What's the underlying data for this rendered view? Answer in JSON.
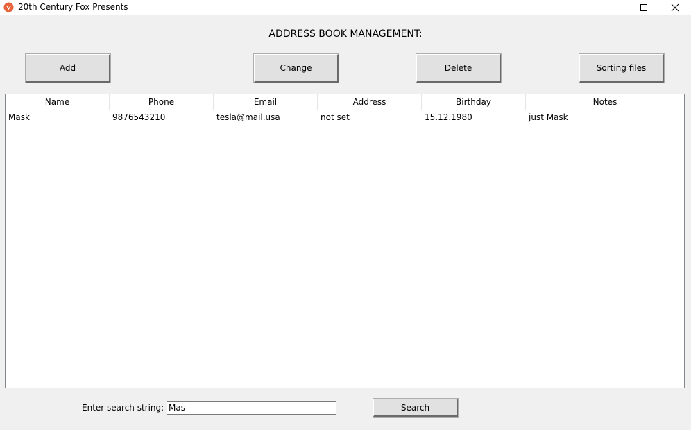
{
  "window": {
    "title": "20th Century Fox Presents",
    "icon": "app-icon",
    "controls": [
      "minimize-icon",
      "maximize-icon",
      "close-icon"
    ]
  },
  "heading": "ADDRESS BOOK MANAGEMENT:",
  "toolbar": {
    "add_label": "Add",
    "change_label": "Change",
    "delete_label": "Delete",
    "sort_label": "Sorting files"
  },
  "table": {
    "columns": [
      "Name",
      "Phone",
      "Email",
      "Address",
      "Birthday",
      "Notes"
    ],
    "rows": [
      [
        "Mask",
        "9876543210",
        "tesla@mail.usa",
        "not set",
        "15.12.1980",
        "just Mask"
      ]
    ]
  },
  "search": {
    "label": "Enter search string:",
    "value": "Mas",
    "button_label": "Search"
  },
  "colors": {
    "window_bg": "#f0f0f0",
    "titlebar_bg": "#ffffff",
    "icon_accent": "#e8623a"
  }
}
